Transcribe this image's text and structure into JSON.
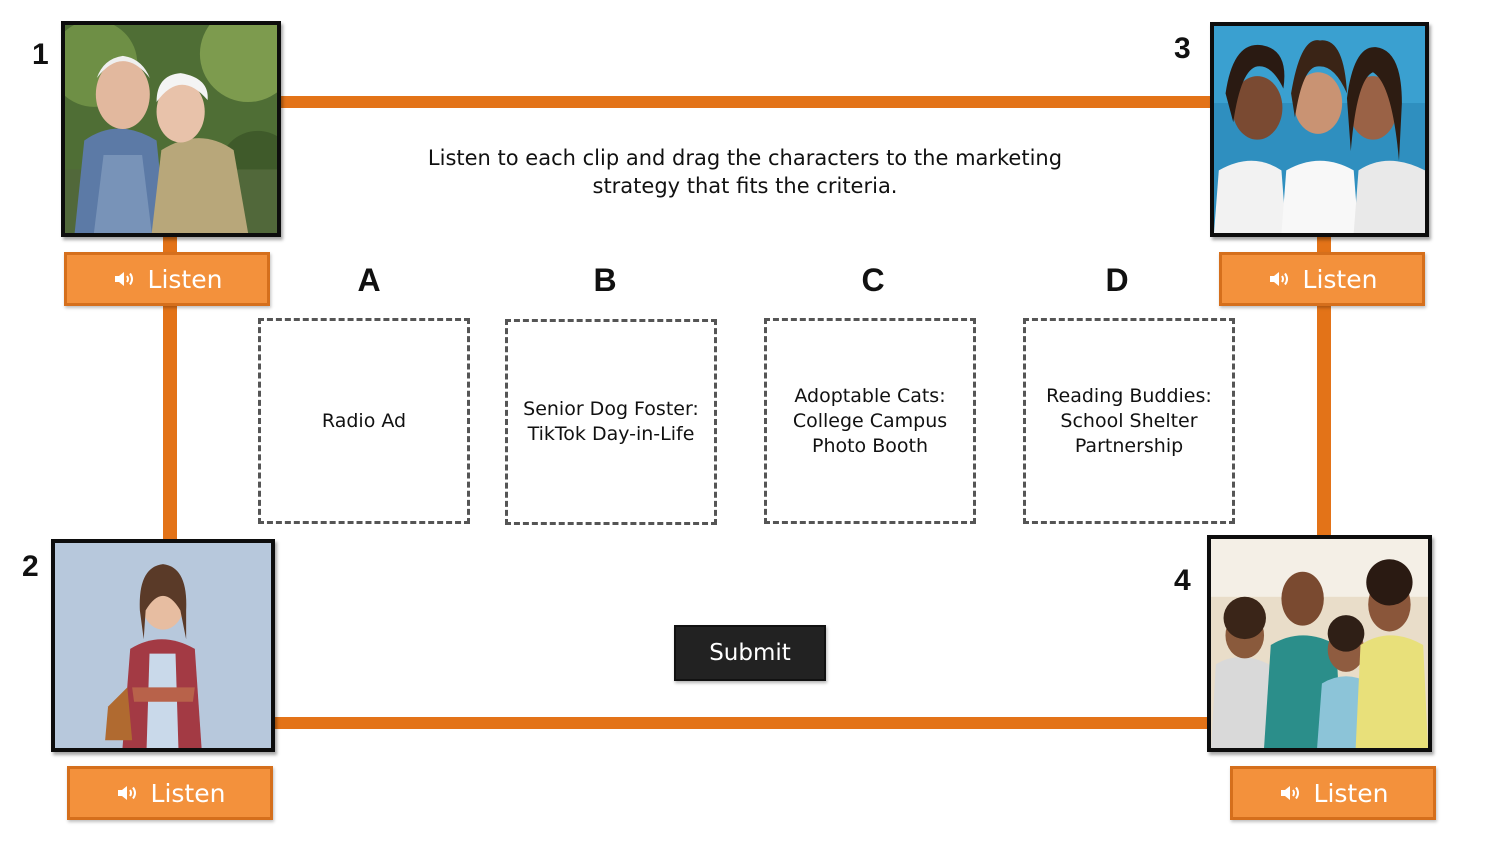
{
  "instructions": "Listen to each clip and drag the characters to the marketing strategy that fits the criteria.",
  "characters": [
    {
      "number": "1",
      "photo": "elderly-couple-photo",
      "listen_label": "Listen"
    },
    {
      "number": "2",
      "photo": "young-woman-photo",
      "listen_label": "Listen"
    },
    {
      "number": "3",
      "photo": "three-young-women-photo",
      "listen_label": "Listen"
    },
    {
      "number": "4",
      "photo": "family-photo",
      "listen_label": "Listen"
    }
  ],
  "strategies": [
    {
      "letter": "A",
      "text": "Radio Ad"
    },
    {
      "letter": "B",
      "text": "Senior Dog Foster: TikTok Day-in-Life"
    },
    {
      "letter": "C",
      "text": "Adoptable Cats: College Campus Photo Booth"
    },
    {
      "letter": "D",
      "text": "Reading Buddies: School Shelter Partnership"
    }
  ],
  "submit_label": "Submit",
  "icons": {
    "listen": "speaker-icon"
  },
  "colors": {
    "accent": "#e37318",
    "button": "#f3913c",
    "submit": "#222222"
  }
}
